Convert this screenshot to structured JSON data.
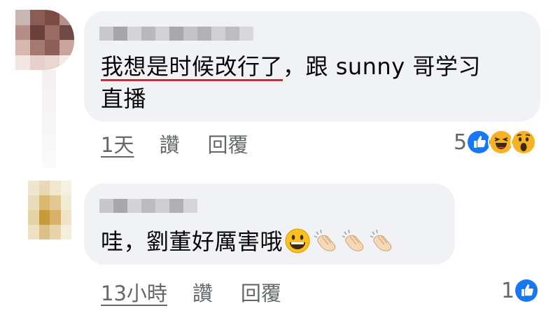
{
  "comments": [
    {
      "message_underlined": "我想是时候改行了",
      "message_rest_line1": "，跟 sunny 哥学习",
      "message_line2": "直播",
      "time": "1天",
      "like": "讚",
      "reply": "回覆",
      "reaction_count": "5",
      "reactions": [
        "like-icon",
        "haha-icon",
        "wow-icon"
      ]
    },
    {
      "message": "哇，劉董好厲害哦",
      "message_emojis": [
        "grinning-face-icon",
        "clapping-hands-icon",
        "clapping-hands-icon",
        "clapping-hands-icon"
      ],
      "time": "13小時",
      "like": "讚",
      "reply": "回覆",
      "reaction_count": "1",
      "reactions": [
        "like-icon"
      ]
    }
  ],
  "colors": {
    "bubble": "#f0f2f5",
    "meta_text": "#65676b",
    "like_blue": "#1877f2",
    "underline_red": "#e0242b"
  }
}
